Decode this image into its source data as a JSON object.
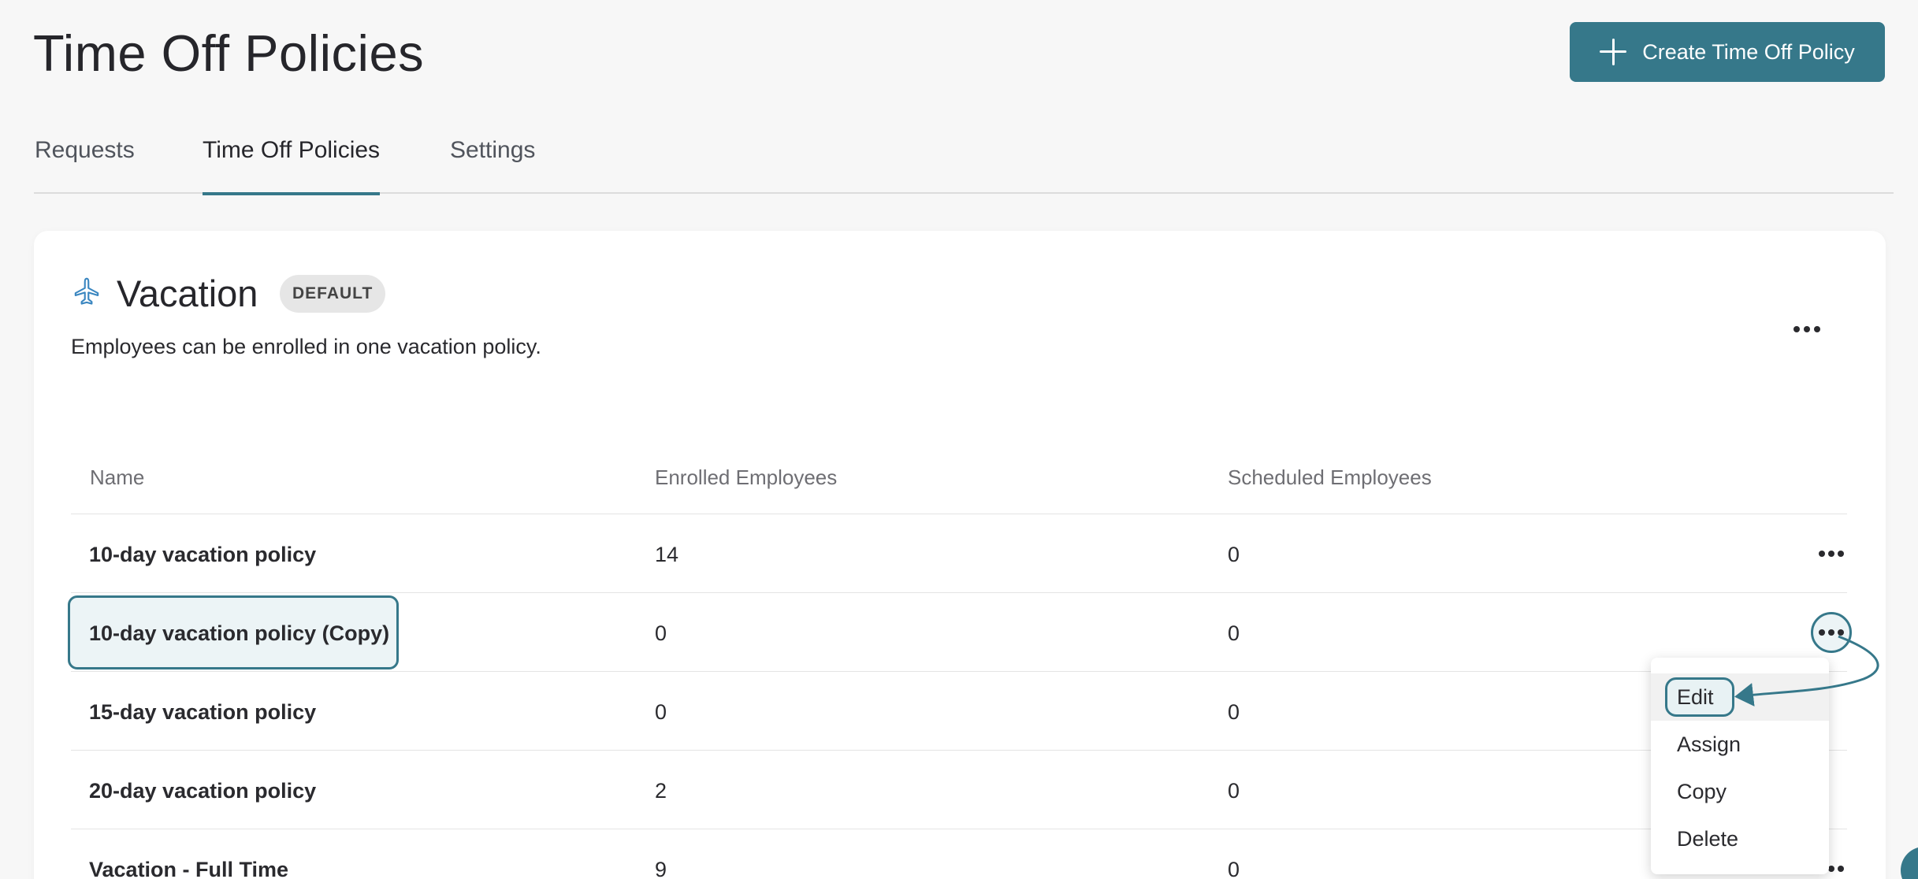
{
  "header": {
    "title": "Time Off Policies",
    "create_button_label": "Create Time Off Policy"
  },
  "tabs": [
    {
      "label": "Requests",
      "active": false
    },
    {
      "label": "Time Off Policies",
      "active": true
    },
    {
      "label": "Settings",
      "active": false
    }
  ],
  "section": {
    "icon": "airplane-icon",
    "title": "Vacation",
    "badge": "DEFAULT",
    "description": "Employees can be enrolled in one vacation policy."
  },
  "table": {
    "columns": [
      "Name",
      "Enrolled Employees",
      "Scheduled Employees"
    ],
    "rows": [
      {
        "name": "10-day vacation policy",
        "enrolled": "14",
        "scheduled": "0"
      },
      {
        "name": "10-day vacation policy (Copy)",
        "enrolled": "0",
        "scheduled": "0"
      },
      {
        "name": "15-day vacation policy",
        "enrolled": "0",
        "scheduled": "0"
      },
      {
        "name": "20-day vacation policy",
        "enrolled": "2",
        "scheduled": "0"
      },
      {
        "name": "Vacation - Full Time",
        "enrolled": "9",
        "scheduled": "0"
      }
    ]
  },
  "row_menu": {
    "items": [
      "Edit",
      "Assign",
      "Copy",
      "Delete"
    ]
  },
  "colors": {
    "accent": "#36788a",
    "background": "#f7f7f7",
    "card": "#ffffff"
  }
}
